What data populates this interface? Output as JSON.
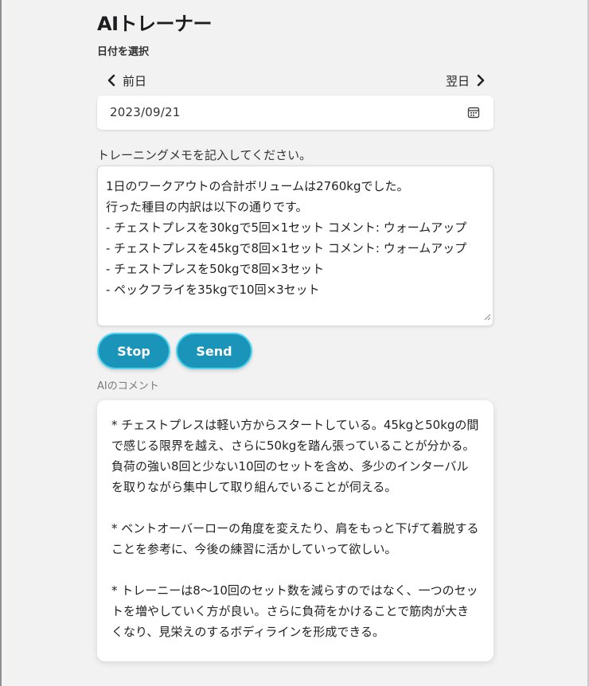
{
  "app": {
    "title": "AIトレーナー"
  },
  "date_picker": {
    "label": "日付を選択",
    "prev_label": "前日",
    "next_label": "翌日",
    "value": "2023/09/21"
  },
  "memo": {
    "label": "トレーニングメモを記入してください。",
    "lines": [
      "1日のワークアウトの合計ボリュームは2760kgでした。",
      "行った種目の内訳は以下の通りです。",
      "- チェストプレスを30kgで5回×1セット コメント: ウォームアップ",
      "- チェストプレスを45kgで8回×1セット コメント: ウォームアップ",
      "- チェストプレスを50kgで8回×3セット",
      "- ペックフライを35kgで10回×3セット"
    ]
  },
  "actions": {
    "stop_label": "Stop",
    "send_label": "Send"
  },
  "ai_comment": {
    "label": "AIのコメント",
    "paragraphs": [
      " * チェストプレスは軽い方からスタートしている。45kgと50kgの間で感じる限界を越え、さらに50kgを踏ん張っていることが分かる。負荷の強い8回と少ない10回のセットを含め、多少のインターバルを取りながら集中して取り組んでいることが伺える。",
      "  * ベントオーバーローの角度を変えたり、肩をもっと下げて着脱することを参考に、今後の練習に活かしていって欲しい。",
      "  * トレーニーは8～10回のセット数を減らすのではなく、一つのセットを増やしていく方が良い。さらに負荷をかけることで筋肉が大きくなり、見栄えのするボディラインを形成できる。"
    ]
  },
  "colors": {
    "button_fill": "#1a94b8",
    "button_border": "#4fd3ef",
    "background": "#f2f2f3"
  },
  "icons": {
    "prev": "chevron-left-icon",
    "next": "chevron-right-icon",
    "calendar": "calendar-icon",
    "resize": "resize-handle-icon"
  }
}
